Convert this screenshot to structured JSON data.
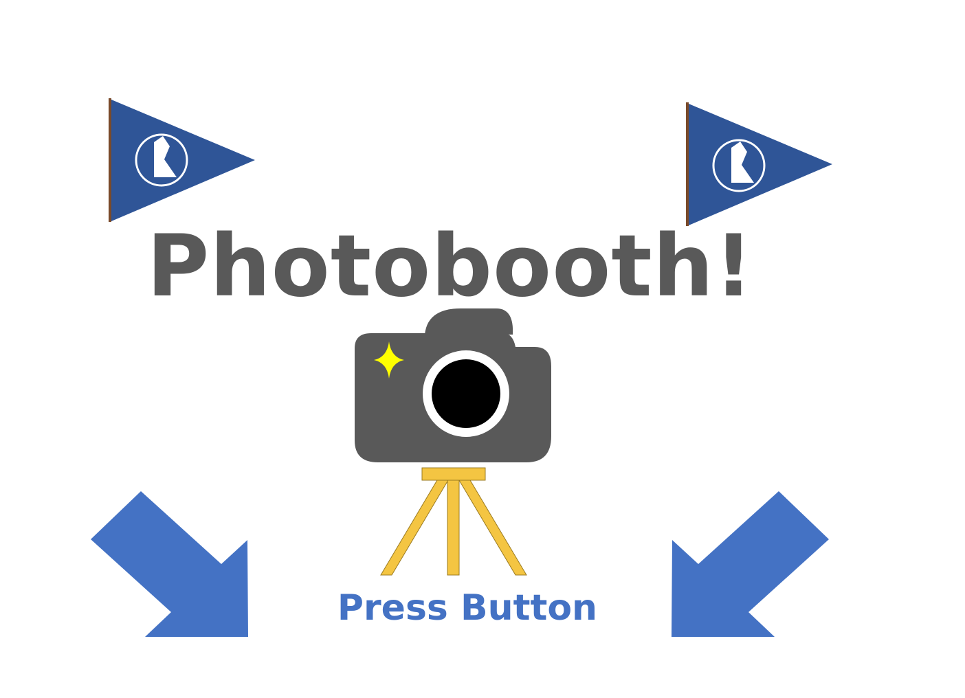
{
  "title": "Photobooth!",
  "call_to_action": "Press Button",
  "icons": {
    "flags": [
      "pennant-flag-icon",
      "pennant-flag-icon"
    ],
    "camera": "camera-on-tripod-icon",
    "flash": "sparkle-icon",
    "arrows": [
      "arrow-down-right-icon",
      "arrow-down-left-icon"
    ]
  },
  "colors": {
    "title": "#595959",
    "call_to_action": "#4472c4",
    "flag_blue": "#2f5597",
    "flag_pole": "#7a4a2a",
    "camera_body": "#595959",
    "lens": "#000000",
    "flash": "#ffff00",
    "tripod": "#f4c542",
    "arrow_blue": "#4472c4"
  }
}
